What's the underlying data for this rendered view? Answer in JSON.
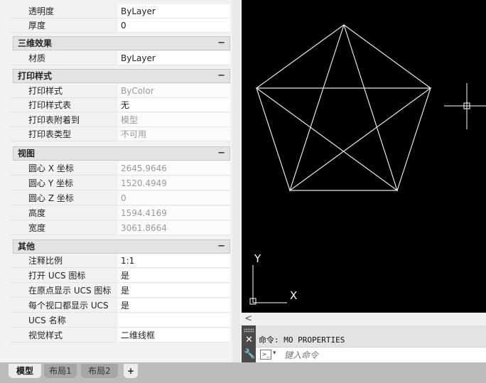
{
  "palette": {
    "rows_top": [
      {
        "name": "透明度",
        "value": "ByLayer",
        "dim": false
      },
      {
        "name": "厚度",
        "value": "0",
        "dim": false
      }
    ],
    "sections": {
      "effects3d": {
        "title": "三维效果",
        "toggle": "−",
        "rows": [
          {
            "name": "材质",
            "value": "ByLayer",
            "dim": false
          }
        ]
      },
      "plot": {
        "title": "打印样式",
        "toggle": "−",
        "rows": [
          {
            "name": "打印样式",
            "value": "ByColor",
            "dim": true
          },
          {
            "name": "打印样式表",
            "value": "无",
            "dim": false
          },
          {
            "name": "打印表附着到",
            "value": "模型",
            "dim": true
          },
          {
            "name": "打印表类型",
            "value": "不可用",
            "dim": true
          }
        ]
      },
      "view": {
        "title": "视图",
        "toggle": "−",
        "rows": [
          {
            "name": "圆心 X 坐标",
            "value": "2645.9646",
            "dim": true
          },
          {
            "name": "圆心 Y 坐标",
            "value": "1520.4949",
            "dim": true
          },
          {
            "name": "圆心 Z 坐标",
            "value": "0",
            "dim": true
          },
          {
            "name": "高度",
            "value": "1594.4169",
            "dim": true
          },
          {
            "name": "宽度",
            "value": "3061.8664",
            "dim": true
          }
        ]
      },
      "misc": {
        "title": "其他",
        "toggle": "−",
        "rows": [
          {
            "name": "注释比例",
            "value": "1:1",
            "dim": false
          },
          {
            "name": "打开 UCS 图标",
            "value": "是",
            "dim": false
          },
          {
            "name": "在原点显示 UCS 图标",
            "value": "是",
            "dim": false
          },
          {
            "name": "每个视口都显示 UCS",
            "value": "是",
            "dim": false
          },
          {
            "name": "UCS 名称",
            "value": "",
            "dim": false
          },
          {
            "name": "视觉样式",
            "value": "二维线框",
            "dim": false
          }
        ]
      }
    }
  },
  "canvas": {
    "background": "#000000",
    "line_color": "#e6e6e6",
    "ucs_x_label": "X",
    "ucs_y_label": "Y"
  },
  "scroll": {
    "left_arrow": "<"
  },
  "cmdline": {
    "history": "命令: MO PROPERTIES",
    "placeholder": "键入命令",
    "close_glyph": "✕",
    "wrench_glyph": "🔧",
    "prompt_glyph": ">_",
    "dropdown_glyph": "▾"
  },
  "tabs": [
    {
      "label": "模型",
      "active": true
    },
    {
      "label": "布局1",
      "active": false
    },
    {
      "label": "布局2",
      "active": false
    }
  ],
  "tab_add": "+"
}
